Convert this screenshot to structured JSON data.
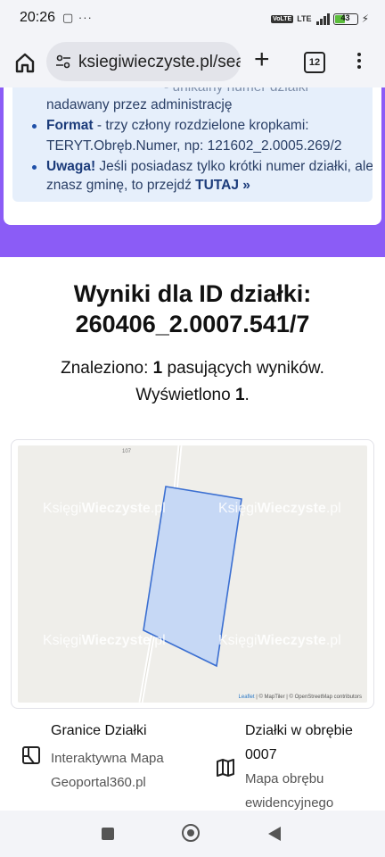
{
  "status_bar": {
    "time": "20:26",
    "left_icons": "▢ ···",
    "volte": "VoLTE",
    "network": "LTE",
    "battery": "43",
    "battery_level": 0.43
  },
  "browser": {
    "url": "ksiegiwieczyste.pl/sea",
    "tab_count": "12"
  },
  "info_box": {
    "line0_tail": "- unikalny numer działki",
    "line1": "nadawany przez administrację",
    "format_label": "Format",
    "format_text": " - trzy człony rozdzielone kropkami:",
    "format_example": "TERYT.Obręb.Numer, np: 121602_2.0005.269/2",
    "warning_label": "Uwaga!",
    "warning_text": " Jeśli posiadasz tylko krótki numer działki, ale",
    "warning_text2": "znasz gminę, to przejdź ",
    "warning_link": "TUTAJ »"
  },
  "results": {
    "title_line1": "Wyniki dla ID działki:",
    "title_line2": "260406_2.0007.541/7",
    "found_prefix": "Znaleziono: ",
    "found_count": "1",
    "found_suffix": " pasujących wyników.",
    "shown_prefix": "Wyświetlono ",
    "shown_count": "1",
    "shown_suffix": "."
  },
  "map": {
    "road_label": "107",
    "watermark_a": "Księgi",
    "watermark_b": "Wieczyste",
    "watermark_c": ".pl",
    "attribution_leaflet": "Leaflet",
    "attribution_rest": " | © MapTiler | © OpenStreetMap contributors",
    "parcel_fill": "#c6d8f5",
    "parcel_stroke": "#3b6fd1"
  },
  "links": {
    "left_title": "Granice Działki",
    "left_sub1": "Interaktywna Mapa",
    "left_sub2": "Geoportal360.pl",
    "right_title1": "Działki w obrębie",
    "right_title2": "0007",
    "right_sub1": "Mapa obrębu",
    "right_sub2": "ewidencyjnego"
  },
  "icons": {
    "home": "home-icon",
    "site_settings": "tune-icon",
    "new_tab": "plus-icon",
    "tabs": "tabs-icon",
    "menu": "more-vert-icon",
    "boundary": "parcel-boundary-icon",
    "map": "map-icon"
  },
  "colors": {
    "accent_purple": "#8b5cf6",
    "info_background": "#e6effb",
    "info_text": "#2a3f66"
  }
}
